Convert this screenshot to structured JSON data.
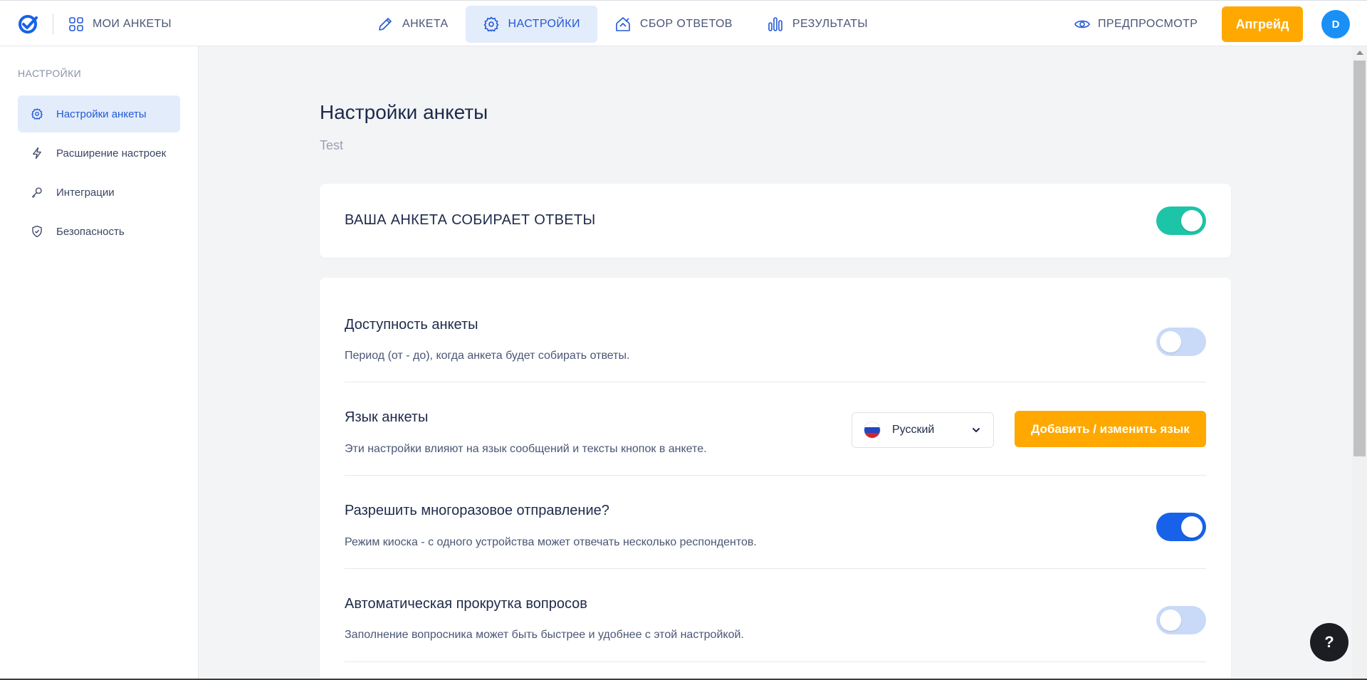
{
  "header": {
    "my_forms_label": "МОИ АНКЕТЫ",
    "tabs": [
      {
        "label": "АНКЕТА",
        "icon": "pencil-icon"
      },
      {
        "label": "НАСТРОЙКИ",
        "icon": "gear-icon",
        "active": true
      },
      {
        "label": "СБОР ОТВЕТОВ",
        "icon": "share-icon"
      },
      {
        "label": "РЕЗУЛЬТАТЫ",
        "icon": "chart-bars-icon"
      }
    ],
    "preview_label": "ПРЕДПРОСМОТР",
    "upgrade_label": "Апгрейд",
    "avatar_initial": "D"
  },
  "sidebar": {
    "title": "НАСТРОЙКИ",
    "items": [
      {
        "label": "Настройки анкеты",
        "icon": "gear-icon",
        "active": true
      },
      {
        "label": "Расширение настроек",
        "icon": "lightning-icon"
      },
      {
        "label": "Интеграции",
        "icon": "key-icon"
      },
      {
        "label": "Безопасность",
        "icon": "shield-icon"
      }
    ]
  },
  "main": {
    "title": "Настройки анкеты",
    "subtitle": "Test",
    "collect": {
      "label": "ВАША АНКЕТА СОБИРАЕТ ОТВЕТЫ",
      "enabled": true
    },
    "settings": [
      {
        "title": "Доступность анкеты",
        "description": "Период (от - до), когда анкета будет собирать ответы.",
        "enabled": false
      },
      {
        "title": "Язык анкеты",
        "description": "Эти настройки влияют на язык сообщений и тексты кнопок в анкете.",
        "language": "Русский",
        "button_label": "Добавить / изменить язык"
      },
      {
        "title": "Разрешить многоразовое отправление?",
        "description": "Режим киоска - с одного устройства может отвечать несколько респондентов.",
        "enabled": true
      },
      {
        "title": "Автоматическая прокрутка вопросов",
        "description": "Заполнение вопросника может быть быстрее и удобнее с этой настройкой.",
        "enabled": false
      }
    ]
  },
  "help_label": "?",
  "colors": {
    "accent": "#2358d6",
    "upgrade": "#ffa800",
    "toggle_teal": "#1ec4a8",
    "toggle_blue": "#1762e8",
    "toggle_off": "#c9daf8"
  }
}
